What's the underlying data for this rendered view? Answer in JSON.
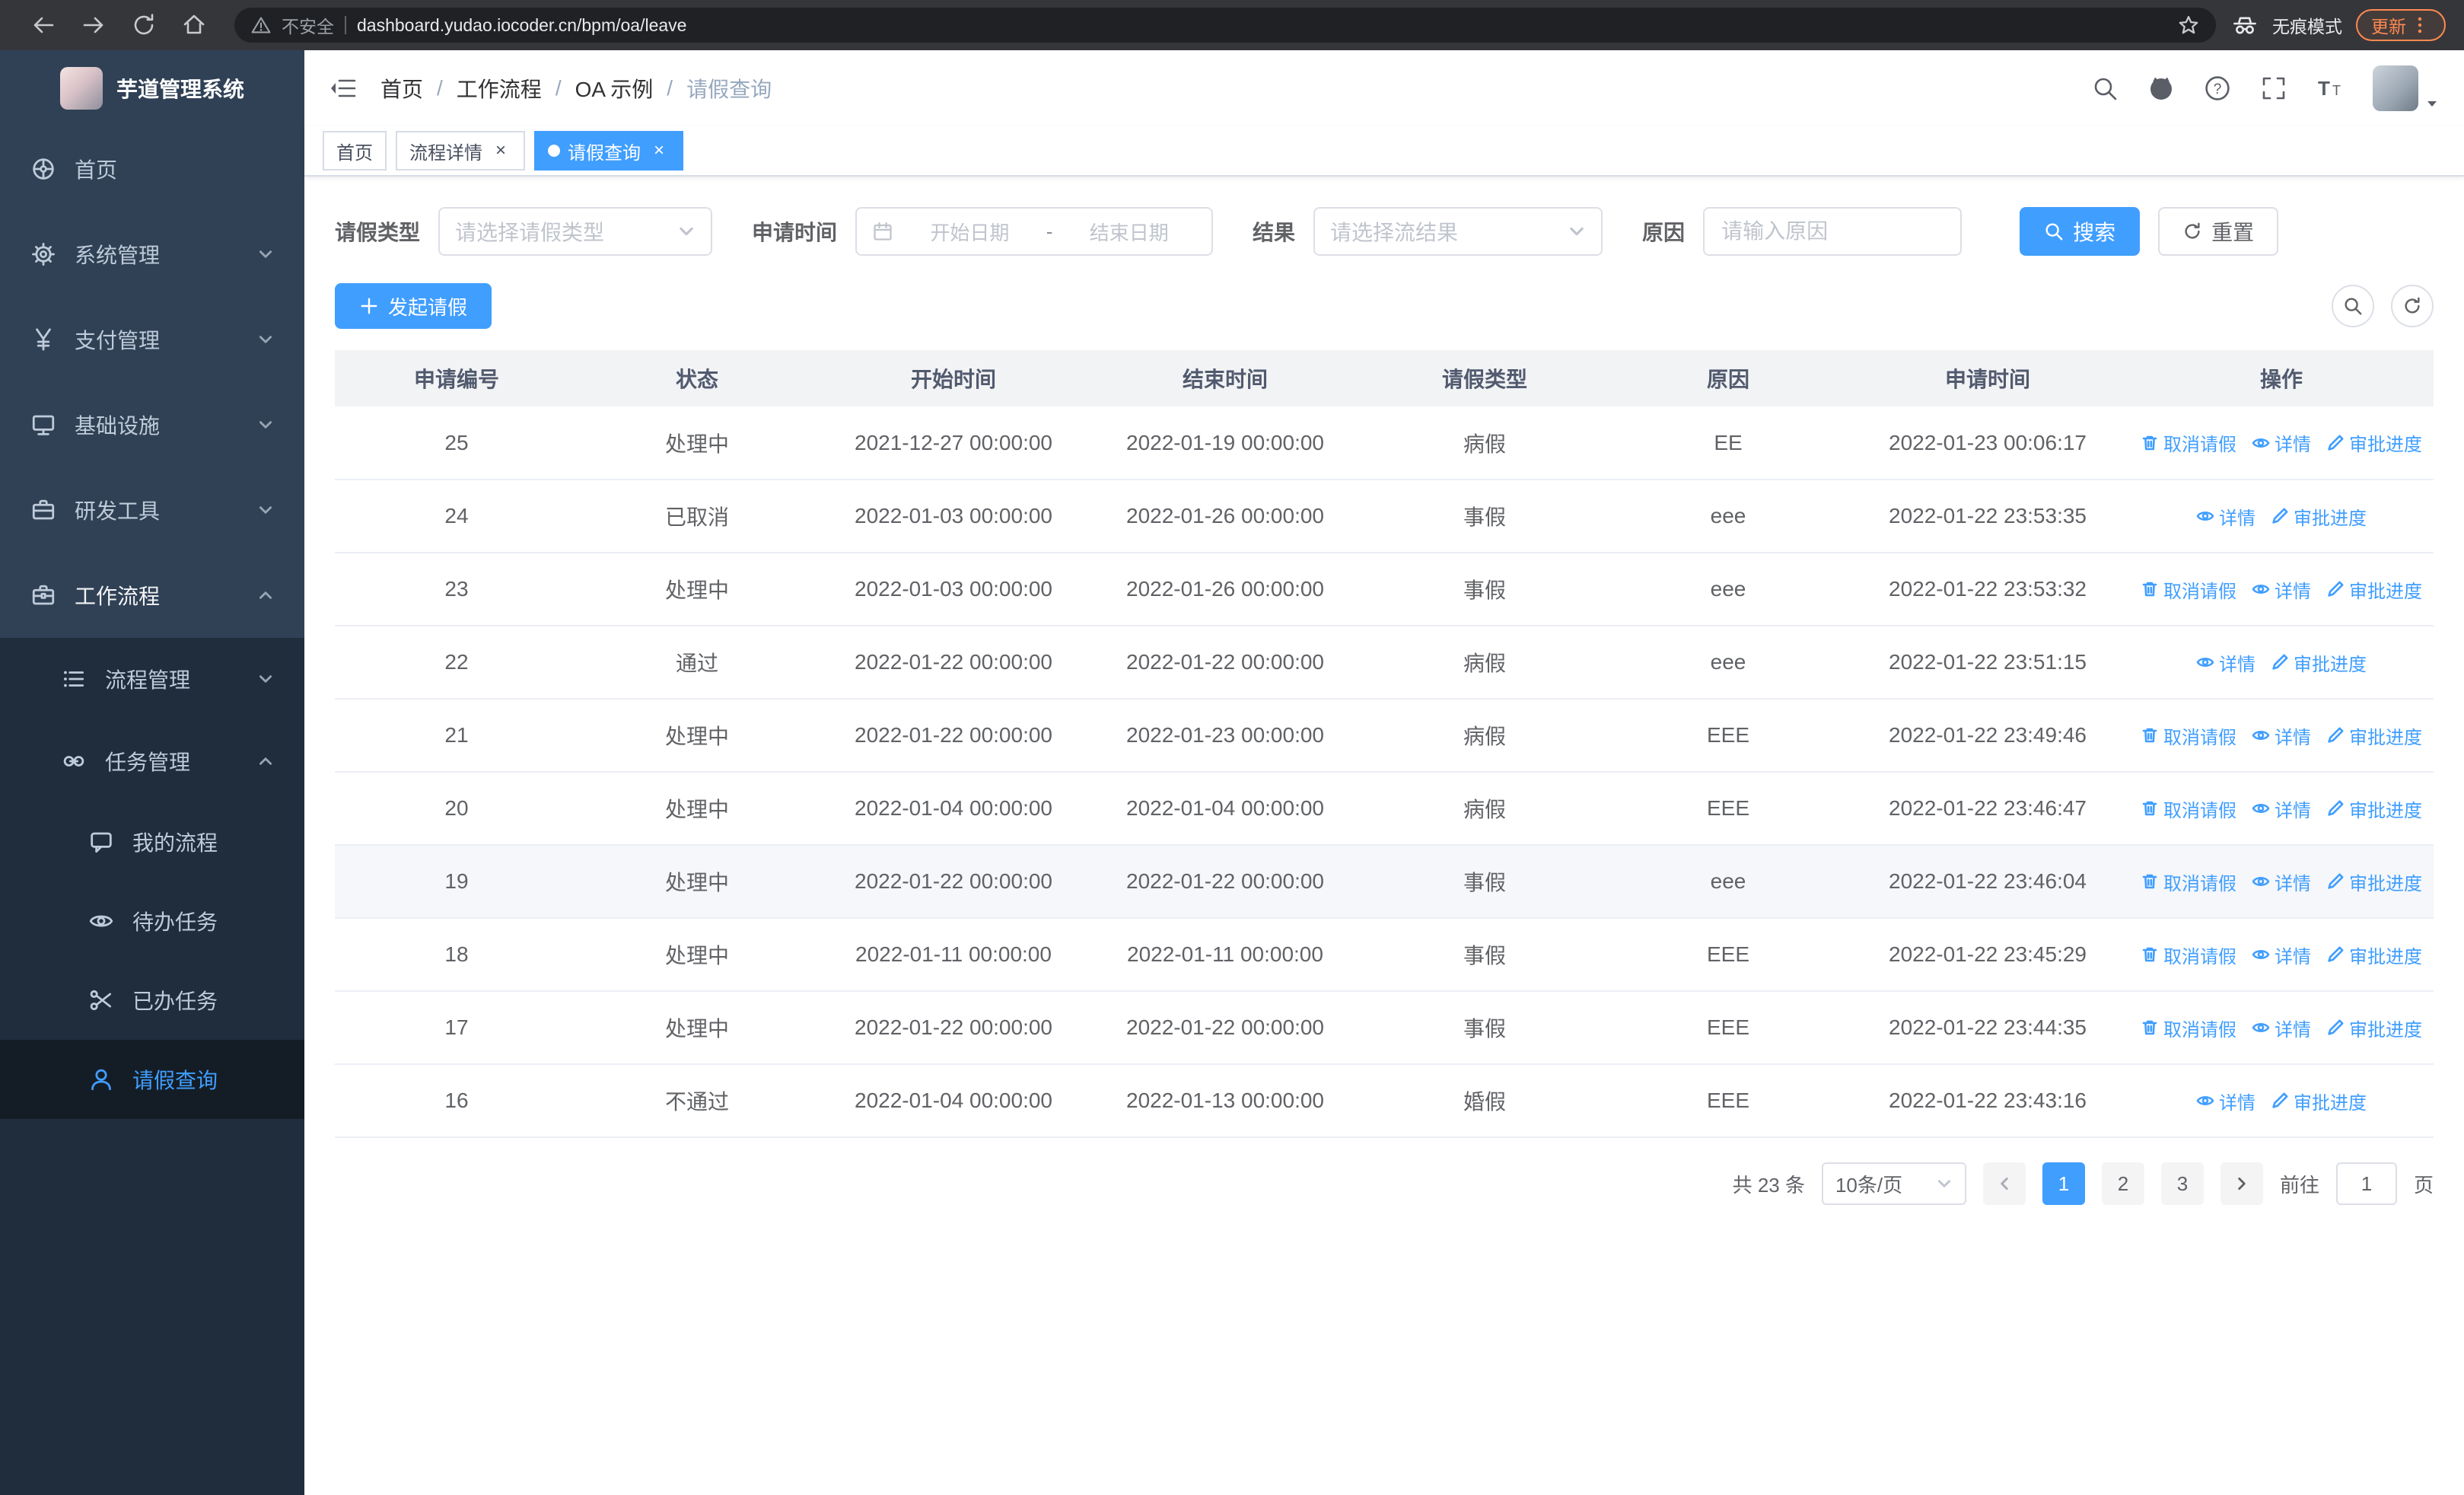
{
  "browser": {
    "security_label": "不安全",
    "url": "dashboard.yudao.iocoder.cn/bpm/oa/leave",
    "incognito_label": "无痕模式",
    "update_label": "更新"
  },
  "sidebar": {
    "logo_title": "芋道管理系统",
    "items": [
      {
        "label": "首页",
        "icon": "dashboard-icon"
      },
      {
        "label": "系统管理",
        "icon": "gear-icon"
      },
      {
        "label": "支付管理",
        "icon": "yen-icon"
      },
      {
        "label": "基础设施",
        "icon": "monitor-icon"
      },
      {
        "label": "研发工具",
        "icon": "toolbox-icon"
      },
      {
        "label": "工作流程",
        "icon": "workflow-icon"
      }
    ],
    "children": [
      {
        "label": "流程管理",
        "icon": "list-icon"
      },
      {
        "label": "任务管理",
        "icon": "link-icon"
      }
    ],
    "tasks": [
      {
        "label": "我的流程",
        "icon": "chat-icon"
      },
      {
        "label": "待办任务",
        "icon": "eye-icon"
      },
      {
        "label": "已办任务",
        "icon": "scissors-icon"
      },
      {
        "label": "请假查询",
        "icon": "user-icon",
        "active": true
      }
    ]
  },
  "header": {
    "breadcrumb": [
      "首页",
      "工作流程",
      "OA 示例",
      "请假查询"
    ],
    "breadcrumb_separator": "/"
  },
  "tags": [
    {
      "label": "首页"
    },
    {
      "label": "流程详情",
      "closable": true
    },
    {
      "label": "请假查询",
      "closable": true,
      "active": true
    }
  ],
  "filters": {
    "leave_type_label": "请假类型",
    "leave_type_placeholder": "请选择请假类型",
    "apply_time_label": "申请时间",
    "start_date_placeholder": "开始日期",
    "range_separator": "-",
    "end_date_placeholder": "结束日期",
    "result_label": "结果",
    "result_placeholder": "请选择流结果",
    "reason_label": "原因",
    "reason_placeholder": "请输入原因",
    "search_button": "搜索",
    "reset_button": "重置"
  },
  "toolbar": {
    "create_button": "发起请假"
  },
  "table": {
    "columns": [
      "申请编号",
      "状态",
      "开始时间",
      "结束时间",
      "请假类型",
      "原因",
      "申请时间",
      "操作"
    ],
    "actions": {
      "cancel": "取消请假",
      "detail": "详情",
      "progress": "审批进度"
    },
    "rows": [
      {
        "id": "25",
        "status": "处理中",
        "start": "2021-12-27 00:00:00",
        "end": "2022-01-19 00:00:00",
        "type": "病假",
        "reason": "EE",
        "apply_time": "2022-01-23 00:06:17",
        "cancellable": true
      },
      {
        "id": "24",
        "status": "已取消",
        "start": "2022-01-03 00:00:00",
        "end": "2022-01-26 00:00:00",
        "type": "事假",
        "reason": "eee",
        "apply_time": "2022-01-22 23:53:35",
        "cancellable": false
      },
      {
        "id": "23",
        "status": "处理中",
        "start": "2022-01-03 00:00:00",
        "end": "2022-01-26 00:00:00",
        "type": "事假",
        "reason": "eee",
        "apply_time": "2022-01-22 23:53:32",
        "cancellable": true
      },
      {
        "id": "22",
        "status": "通过",
        "start": "2022-01-22 00:00:00",
        "end": "2022-01-22 00:00:00",
        "type": "病假",
        "reason": "eee",
        "apply_time": "2022-01-22 23:51:15",
        "cancellable": false
      },
      {
        "id": "21",
        "status": "处理中",
        "start": "2022-01-22 00:00:00",
        "end": "2022-01-23 00:00:00",
        "type": "病假",
        "reason": "EEE",
        "apply_time": "2022-01-22 23:49:46",
        "cancellable": true
      },
      {
        "id": "20",
        "status": "处理中",
        "start": "2022-01-04 00:00:00",
        "end": "2022-01-04 00:00:00",
        "type": "病假",
        "reason": "EEE",
        "apply_time": "2022-01-22 23:46:47",
        "cancellable": true
      },
      {
        "id": "19",
        "status": "处理中",
        "start": "2022-01-22 00:00:00",
        "end": "2022-01-22 00:00:00",
        "type": "事假",
        "reason": "eee",
        "apply_time": "2022-01-22 23:46:04",
        "cancellable": true,
        "hover": true
      },
      {
        "id": "18",
        "status": "处理中",
        "start": "2022-01-11 00:00:00",
        "end": "2022-01-11 00:00:00",
        "type": "事假",
        "reason": "EEE",
        "apply_time": "2022-01-22 23:45:29",
        "cancellable": true
      },
      {
        "id": "17",
        "status": "处理中",
        "start": "2022-01-22 00:00:00",
        "end": "2022-01-22 00:00:00",
        "type": "事假",
        "reason": "EEE",
        "apply_time": "2022-01-22 23:44:35",
        "cancellable": true
      },
      {
        "id": "16",
        "status": "不通过",
        "start": "2022-01-04 00:00:00",
        "end": "2022-01-13 00:00:00",
        "type": "婚假",
        "reason": "EEE",
        "apply_time": "2022-01-22 23:43:16",
        "cancellable": false
      }
    ]
  },
  "pagination": {
    "total_label": "共 23 条",
    "page_size": "10条/页",
    "pages": [
      "1",
      "2",
      "3"
    ],
    "active_page": "1",
    "goto_label": "前往",
    "goto_value": "1",
    "page_unit": "页"
  },
  "colors": {
    "primary": "#409eff",
    "sidebar_bg": "#304156",
    "submenu_bg": "#1f2d3d",
    "active_item_bg": "#141d26"
  }
}
